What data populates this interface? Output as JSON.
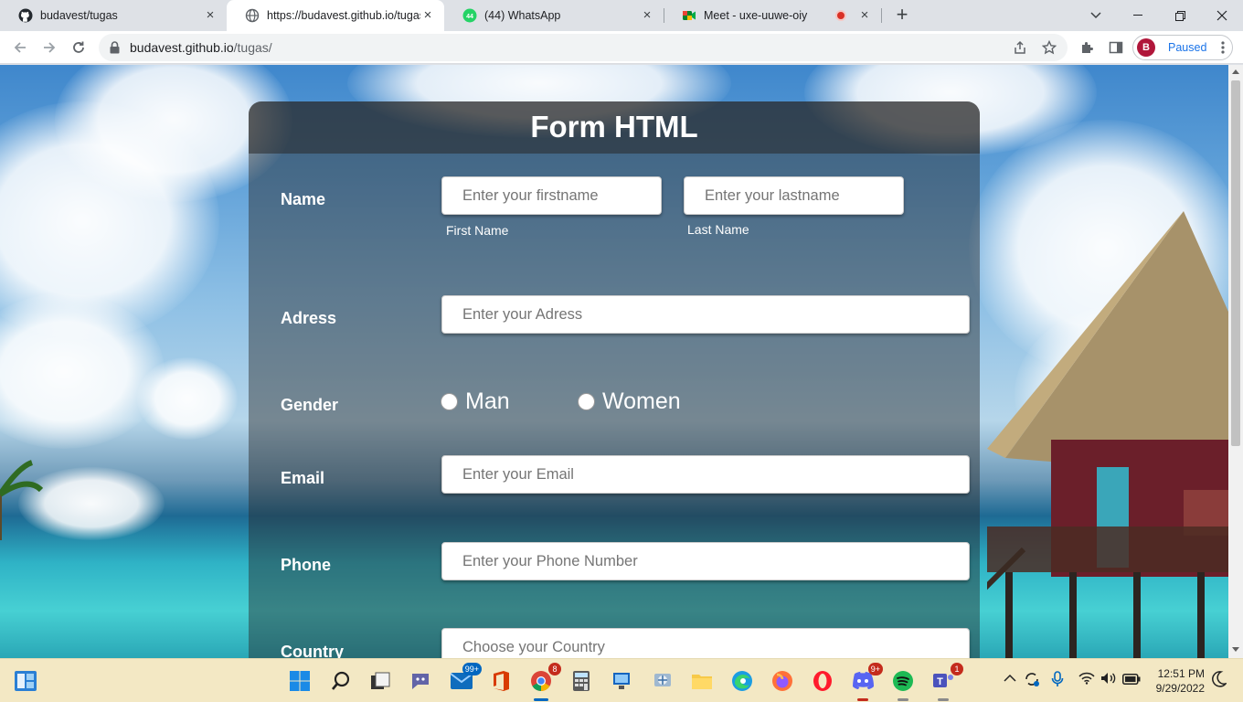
{
  "browser": {
    "tabs": [
      {
        "title": "budavest/tugas",
        "icon": "github-icon"
      },
      {
        "title": "https://budavest.github.io/tugas/",
        "icon": "globe-icon"
      },
      {
        "title": "(44) WhatsApp",
        "icon": "whatsapp-icon",
        "badge": "44"
      },
      {
        "title": "Meet - uxe-uuwe-oiy",
        "icon": "meet-icon"
      }
    ],
    "new_tab_label": "+",
    "address": {
      "host": "budavest.github.io",
      "path": "/tugas/"
    },
    "profile": {
      "initial": "B",
      "status": "Paused"
    }
  },
  "form": {
    "title": "Form HTML",
    "name": {
      "label": "Name",
      "firstname_placeholder": "Enter your firstname",
      "lastname_placeholder": "Enter your lastname",
      "firstname_sublabel": "First Name",
      "lastname_sublabel": "Last Name"
    },
    "address": {
      "label": "Adress",
      "placeholder": "Enter your Adress"
    },
    "gender": {
      "label": "Gender",
      "options": [
        "Man",
        "Women"
      ]
    },
    "email": {
      "label": "Email",
      "placeholder": "Enter your Email"
    },
    "phone": {
      "label": "Phone",
      "placeholder": "Enter your Phone Number"
    },
    "country": {
      "label": "Country",
      "placeholder": "Choose your Country"
    }
  },
  "taskbar": {
    "badges": {
      "mail": "99+",
      "chrome": "8",
      "discord": "9+",
      "teams": "1"
    },
    "time": "12:51 PM",
    "date": "9/29/2022"
  },
  "colors": {
    "accent": "#1a73e8",
    "profile_avatar": "#b0163a",
    "form_overlay": "#282828",
    "taskbar": "#f3e8c4"
  }
}
